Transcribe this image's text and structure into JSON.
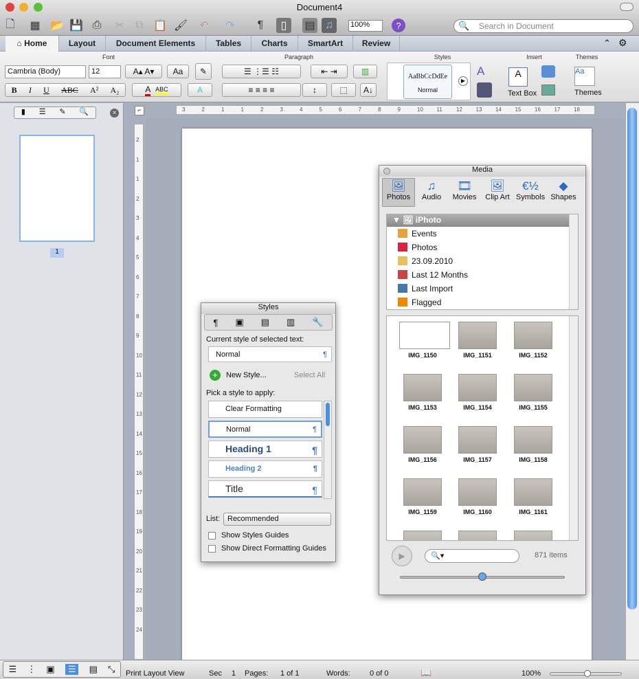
{
  "window": {
    "title": "Document4"
  },
  "toolbar": {
    "zoom": "100%",
    "search_placeholder": "Search in Document"
  },
  "tabs": [
    "Home",
    "Layout",
    "Document Elements",
    "Tables",
    "Charts",
    "SmartArt",
    "Review"
  ],
  "ribbon": {
    "groups": {
      "font": "Font",
      "paragraph": "Paragraph",
      "styles": "Styles",
      "insert": "Insert",
      "themes": "Themes"
    },
    "font_name": "Cambria (Body)",
    "font_size": "12",
    "style_preview": "AaBbCcDdEe",
    "style_name": "Normal",
    "text_box": "Text Box",
    "themes": "Themes",
    "colors": {
      "font_color": "#e00000",
      "highlight": "#ffff00"
    }
  },
  "sidebar": {
    "page_number": "1"
  },
  "ruler": {
    "h_ticks": [
      "3",
      "2",
      "1",
      "1",
      "2",
      "3",
      "4",
      "5",
      "6",
      "7",
      "8",
      "9",
      "10",
      "11",
      "12",
      "13",
      "14",
      "15",
      "16",
      "17",
      "18"
    ],
    "v_ticks": [
      "2",
      "1",
      "1",
      "2",
      "3",
      "4",
      "5",
      "6",
      "7",
      "8",
      "9",
      "10",
      "11",
      "12",
      "13",
      "14",
      "15",
      "16",
      "17",
      "18",
      "19",
      "20",
      "21",
      "22",
      "23",
      "24"
    ]
  },
  "styles_panel": {
    "title": "Styles",
    "current_label": "Current style of selected text:",
    "current_value": "Normal",
    "new_style": "New Style...",
    "select_all": "Select All",
    "pick_label": "Pick a style to apply:",
    "items": [
      "Clear Formatting",
      "Normal",
      "Heading 1",
      "Heading 2",
      "Title"
    ],
    "list_label": "List:",
    "list_value": "Recommended",
    "show_guides": "Show Styles Guides",
    "show_direct": "Show Direct Formatting Guides"
  },
  "media_panel": {
    "title": "Media",
    "tabs": [
      "Photos",
      "Audio",
      "Movies",
      "Clip Art",
      "Symbols",
      "Shapes"
    ],
    "source": "iPhoto",
    "tree": [
      "Events",
      "Photos",
      "23.09.2010",
      "Last 12 Months",
      "Last Import",
      "Flagged"
    ],
    "photos": [
      "IMG_1150",
      "IMG_1151",
      "IMG_1152",
      "IMG_1153",
      "IMG_1154",
      "IMG_1155",
      "IMG_1156",
      "IMG_1157",
      "IMG_1158",
      "IMG_1159",
      "IMG_1160",
      "IMG_1161"
    ],
    "count": "871 items"
  },
  "status": {
    "view": "Print Layout View",
    "sec_label": "Sec",
    "sec": "1",
    "pages_label": "Pages:",
    "pages": "1 of 1",
    "words_label": "Words:",
    "words": "0 of 0",
    "zoom": "100%",
    "zoom_level": 0.5
  }
}
